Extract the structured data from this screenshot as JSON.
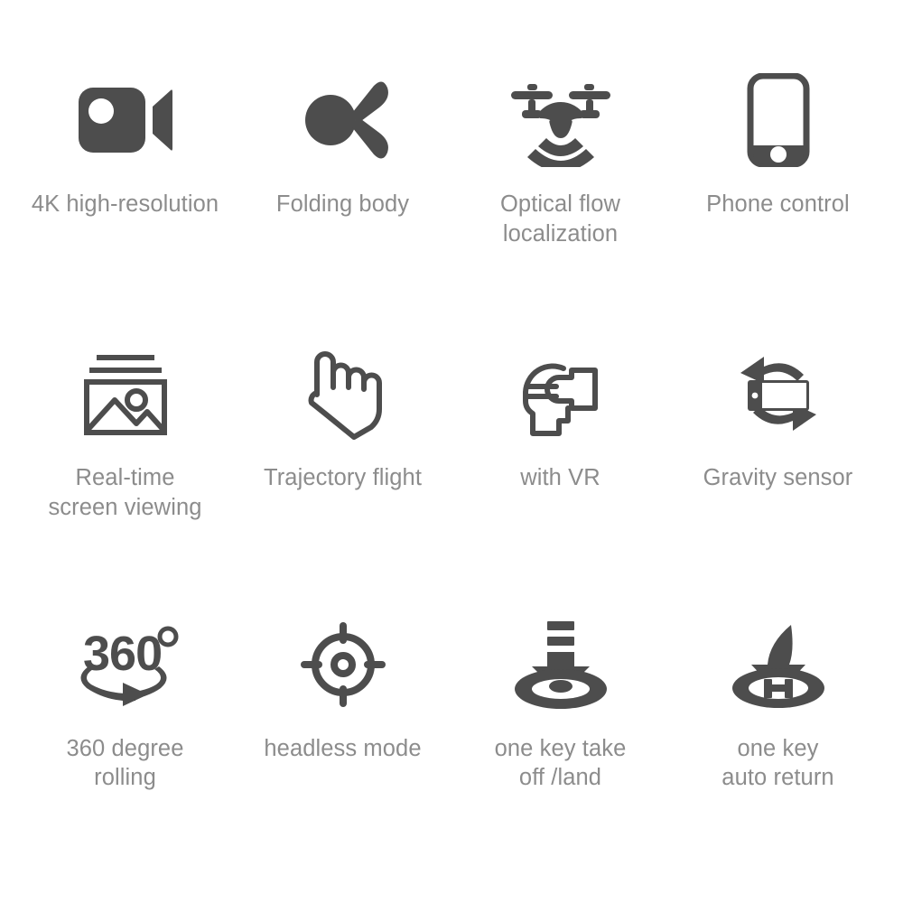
{
  "page": {
    "background_color": "#ffffff",
    "icon_color": "#4d4d4d",
    "label_color": "#8c8c8c"
  },
  "features": [
    {
      "icon": "video-camera-icon",
      "label": "4K high-resolution"
    },
    {
      "icon": "folding-propeller-icon",
      "label": "Folding body"
    },
    {
      "icon": "drone-signal-icon",
      "label": "Optical flow\nlocalization"
    },
    {
      "icon": "smartphone-icon",
      "label": "Phone control"
    },
    {
      "icon": "photo-gallery-icon",
      "label": "Real-time\nscreen viewing"
    },
    {
      "icon": "pointing-hand-icon",
      "label": "Trajectory flight"
    },
    {
      "icon": "vr-headset-icon",
      "label": "with VR"
    },
    {
      "icon": "device-rotate-icon",
      "label": "Gravity sensor"
    },
    {
      "icon": "360-rotation-icon",
      "label": "360 degree\nrolling"
    },
    {
      "icon": "crosshair-target-icon",
      "label": "headless mode"
    },
    {
      "icon": "arrow-down-landing-icon",
      "label": "one key take\noff /land"
    },
    {
      "icon": "curved-arrow-helipad-icon",
      "label": "one key\nauto return"
    }
  ]
}
